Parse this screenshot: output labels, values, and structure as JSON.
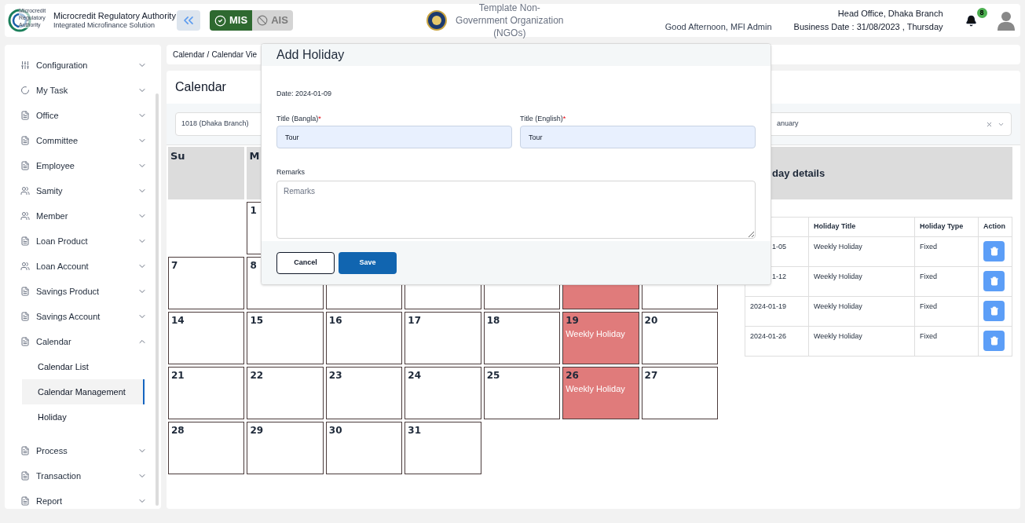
{
  "header": {
    "org_name": "Microcredit Regulatory Authority",
    "org_subtitle": "Integrated Microfinance Solution",
    "logo_lines": [
      "Microcredit",
      "Regulatory",
      "Authority"
    ],
    "modes": [
      {
        "label": "MIS",
        "selected": true
      },
      {
        "label": "AIS",
        "selected": false
      }
    ],
    "center_org": "Template Non-Government Organization (NGOs)",
    "greeting": "Good Afternoon, MFI Admin",
    "branch": "Head Office, Dhaka Branch",
    "business_date": "Business Date : 31/08/2023 , Thursday",
    "notification_count": "8"
  },
  "sidebar": {
    "items": [
      {
        "label": "Configuration",
        "expanded": false
      },
      {
        "label": "My Task",
        "expanded": false
      },
      {
        "label": "Office",
        "expanded": false
      },
      {
        "label": "Committee",
        "expanded": false
      },
      {
        "label": "Employee",
        "expanded": false
      },
      {
        "label": "Samity",
        "expanded": false
      },
      {
        "label": "Member",
        "expanded": false
      },
      {
        "label": "Loan Product",
        "expanded": false
      },
      {
        "label": "Loan Account",
        "expanded": false
      },
      {
        "label": "Savings Product",
        "expanded": false
      },
      {
        "label": "Savings Account",
        "expanded": false
      },
      {
        "label": "Calendar",
        "expanded": true,
        "children": [
          {
            "label": "Calendar List",
            "selected": false
          },
          {
            "label": "Calendar Management",
            "selected": true
          },
          {
            "label": "Holiday",
            "selected": false
          }
        ]
      },
      {
        "label": "Process",
        "expanded": false
      },
      {
        "label": "Transaction",
        "expanded": false
      },
      {
        "label": "Report",
        "expanded": false
      }
    ]
  },
  "breadcrumb": [
    "Calendar",
    "/",
    "Calendar Vie"
  ],
  "page_title": "Calendar",
  "filters": {
    "branch": "1018 (Dhaka Branch)",
    "month": "anuary"
  },
  "calendar": {
    "weekdays": [
      "Su",
      "M"
    ],
    "weeks": [
      [
        {
          "kind": "empty"
        },
        {
          "day": "1"
        }
      ],
      [
        {
          "day": "7",
          "holiday": false
        },
        {
          "day": "8",
          "holiday": false
        },
        {
          "holiday": false
        },
        {
          "holiday": false
        },
        {
          "holiday": false
        },
        {
          "holiday": true
        },
        {
          "holiday": false
        }
      ],
      [
        {
          "day": "14",
          "holiday": false
        },
        {
          "day": "15",
          "holiday": false
        },
        {
          "day": "16",
          "holiday": false
        },
        {
          "day": "17",
          "holiday": false
        },
        {
          "day": "18",
          "holiday": false
        },
        {
          "day": "19",
          "holiday": true,
          "label": "Weekly Holiday"
        },
        {
          "day": "20",
          "holiday": false
        }
      ],
      [
        {
          "day": "21",
          "holiday": false
        },
        {
          "day": "22",
          "holiday": false
        },
        {
          "day": "23",
          "holiday": false
        },
        {
          "day": "24",
          "holiday": false
        },
        {
          "day": "25",
          "holiday": false
        },
        {
          "day": "26",
          "holiday": true,
          "label": "Weekly Holiday"
        },
        {
          "day": "27",
          "holiday": false
        }
      ],
      [
        {
          "day": "28",
          "holiday": false
        },
        {
          "day": "29",
          "holiday": false
        },
        {
          "day": "30",
          "holiday": false
        },
        {
          "day": "31",
          "holiday": false
        }
      ]
    ]
  },
  "holiday_details": {
    "title": "day details",
    "columns": [
      "",
      "Holiday Title",
      "Holiday Type",
      "Action"
    ],
    "rows": [
      [
        "1-05",
        "Weekly Holiday",
        "Fixed"
      ],
      [
        "1-12",
        "Weekly Holiday",
        "Fixed"
      ],
      [
        "2024-01-19",
        "Weekly Holiday",
        "Fixed"
      ],
      [
        "2024-01-26",
        "Weekly Holiday",
        "Fixed"
      ]
    ]
  },
  "modal": {
    "title": "Add Holiday",
    "date": "Date: 2024-01-09",
    "title_bangla_label": "Title (Bangla)",
    "title_bangla_value": "Tour",
    "title_english_label": "Title (English)",
    "title_english_value": "Tour",
    "required_mark": "*",
    "remarks_label": "Remarks",
    "remarks_placeholder": "Remarks",
    "buttons": [
      "Cancel",
      "Save"
    ]
  }
}
